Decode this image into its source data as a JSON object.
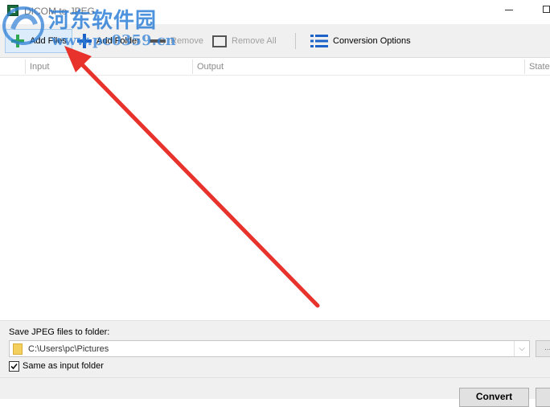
{
  "window": {
    "title": "DICOM to JPEG"
  },
  "watermark": {
    "title": "河东软件园",
    "url": "www.pc0359.cn"
  },
  "toolbar": {
    "add_files": "Add Files",
    "add_folder": "Add Folder",
    "remove": "Remove",
    "remove_all": "Remove All",
    "conversion_options": "Conversion Options"
  },
  "file_list": {
    "columns": [
      "Input",
      "Output",
      "State"
    ]
  },
  "output": {
    "save_label": "Save JPEG files to folder:",
    "folder_path": "C:\\Users\\pc\\Pictures",
    "browse_label": "...",
    "same_as_input_label": "Same as input folder",
    "same_as_input_checked": true
  },
  "actions": {
    "convert_label": "Convert"
  },
  "colors": {
    "accent_green": "#2fa84f",
    "accent_blue": "#1d63c7",
    "annotation_red": "#e8322c",
    "watermark_blue": "#2f7fd6"
  }
}
